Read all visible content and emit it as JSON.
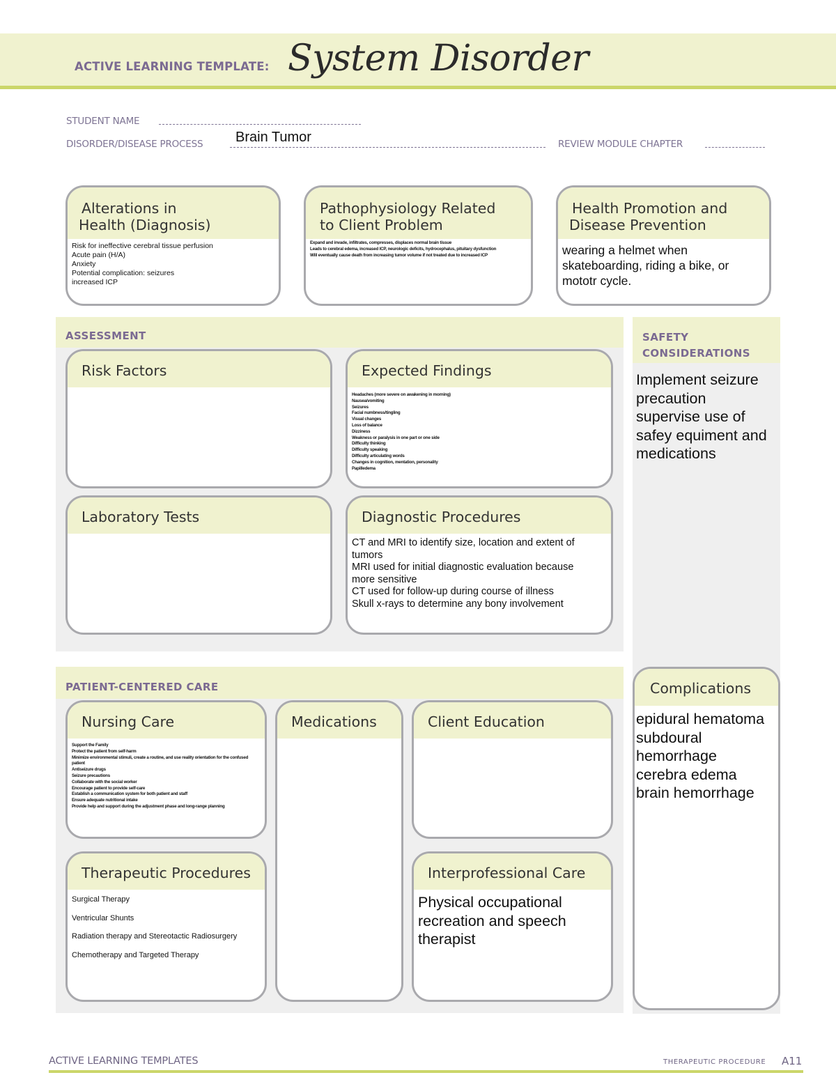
{
  "header": {
    "kicker": "ACTIVE LEARNING TEMPLATE:",
    "title": "System Disorder"
  },
  "fields": {
    "student_name_label": "STUDENT NAME",
    "student_name_value": "",
    "disorder_label": "DISORDER/DISEASE PROCESS",
    "disorder_value": "Brain Tumor",
    "review_module_label": "REVIEW MODULE CHAPTER",
    "review_module_value": ""
  },
  "top_cards": {
    "alterations": {
      "title_line1": "Alterations in",
      "title_line2": "Health (Diagnosis)",
      "items": [
        "Risk for ineffective cerebral tissue perfusion",
        "Acute pain (H/A)",
        "Anxiety",
        "Potential complication: seizures",
        "increased ICP"
      ]
    },
    "pathophysiology": {
      "title_line1": "Pathophysiology Related",
      "title_line2": "to Client Problem",
      "items": [
        "Expand and invade, infiltrates, compresses, displaces normal brain tissue",
        "Leads to cerebral edema, increased ICP, neurologic deficits, hydrocephalus, pituitary dysfunction",
        "Will eventually cause death from increasing tumor volume if not treated due to increased ICP"
      ]
    },
    "health_promotion": {
      "title_line1": "Health Promotion and",
      "title_line2": "Disease Prevention",
      "items": [
        "wearing a helmet when skateboarding, riding a bike, or mototr cycle."
      ]
    }
  },
  "assessment": {
    "label": "ASSESSMENT",
    "risk_factors": {
      "title": "Risk Factors",
      "items": []
    },
    "expected_findings": {
      "title": "Expected Findings",
      "items": [
        "Headaches (more severe on awakening in morning)",
        "Nausea/vomiting",
        "Seizures",
        "Facial numbness/tingling",
        "Visual changes",
        "Loss of balance",
        "Dizziness",
        "Weakness or paralysis in one part or one side",
        "Difficulty thinking",
        "Difficulty speaking",
        "Difficulty articulating words",
        "Changes in cognition, mentation, personality",
        "Papilledema"
      ]
    },
    "laboratory_tests": {
      "title": "Laboratory Tests",
      "items": []
    },
    "diagnostic_procedures": {
      "title": "Diagnostic Procedures",
      "items": [
        "CT and MRI to identify size, location and extent of tumors",
        "MRI used for initial diagnostic evaluation because more sensitive",
        "CT used for follow-up during course of illness",
        "Skull x-rays to determine any bony involvement"
      ]
    }
  },
  "safety": {
    "label_line1": "SAFETY",
    "label_line2": "CONSIDERATIONS",
    "items": [
      "Implement seizure precaution",
      "supervise use of safey equiment and medications"
    ]
  },
  "patient_centered_care": {
    "label": "PATIENT-CENTERED CARE",
    "nursing_care": {
      "title": "Nursing Care",
      "items": [
        "Support the Family",
        "Protect the patient from self-harm",
        "Minimize environmental stimuli, create a routine, and use reality orientation for the confused patient",
        "Antiseizure drugs",
        "Seizure precautions",
        "Collaborate with the social worker",
        "Encourage patient to provide self-care",
        "Establish a communication system for both patient and staff",
        "Ensure adequate nutritional intake",
        "Provide help and support during the adjustment phase and long-range planning"
      ]
    },
    "medications": {
      "title": "Medications",
      "items": []
    },
    "client_education": {
      "title": "Client Education",
      "items": []
    },
    "therapeutic_procedures": {
      "title": "Therapeutic Procedures",
      "items": [
        "Surgical Therapy",
        "Ventricular Shunts",
        "Radiation therapy and Stereotactic Radiosurgery",
        "Chemotherapy and Targeted Therapy"
      ]
    },
    "interprofessional_care": {
      "title": "Interprofessional Care",
      "items": [
        "Physical occupational recreation and speech therapist"
      ]
    }
  },
  "complications": {
    "title": "Complications",
    "items": [
      "epidural hematoma",
      "subdoural hemorrhage",
      "cerebra edema",
      "brain hemorrhage"
    ]
  },
  "footer": {
    "left": "ACTIVE LEARNING TEMPLATES",
    "right_label": "THERAPEUTIC PROCEDURE",
    "page": "A11"
  }
}
